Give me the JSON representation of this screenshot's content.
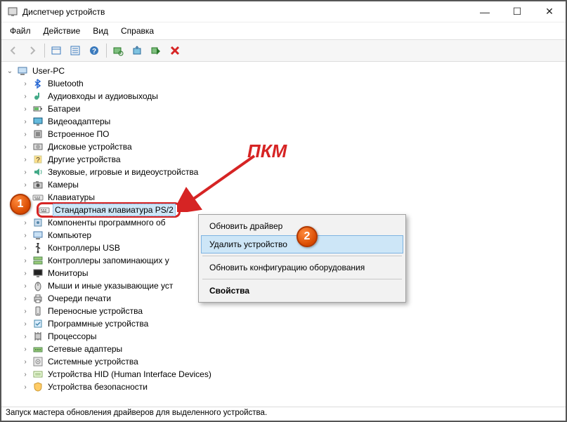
{
  "window": {
    "title": "Диспетчер устройств",
    "controls": {
      "min": "—",
      "max": "☐",
      "close": "✕"
    }
  },
  "menubar": [
    "Файл",
    "Действие",
    "Вид",
    "Справка"
  ],
  "tree": {
    "root": "User-PC",
    "items": [
      {
        "label": "Bluetooth",
        "icon": "bluetooth"
      },
      {
        "label": "Аудиовходы и аудиовыходы",
        "icon": "audio"
      },
      {
        "label": "Батареи",
        "icon": "battery"
      },
      {
        "label": "Видеоадаптеры",
        "icon": "display"
      },
      {
        "label": "Встроенное ПО",
        "icon": "firmware"
      },
      {
        "label": "Дисковые устройства",
        "icon": "disk"
      },
      {
        "label": "Другие устройства",
        "icon": "other"
      },
      {
        "label": "Звуковые, игровые и видеоустройства",
        "icon": "sound"
      },
      {
        "label": "Камеры",
        "icon": "camera"
      },
      {
        "label": "Клавиатуры",
        "icon": "keyboard",
        "expanded": true,
        "children": [
          {
            "label": "Стандартная клавиатура PS/2",
            "icon": "keyboard",
            "selected": true
          }
        ]
      },
      {
        "label": "Компоненты программного об",
        "icon": "software",
        "truncated": true
      },
      {
        "label": "Компьютер",
        "icon": "computer"
      },
      {
        "label": "Контроллеры USB",
        "icon": "usb"
      },
      {
        "label": "Контроллеры запоминающих у",
        "icon": "storage",
        "truncated": true
      },
      {
        "label": "Мониторы",
        "icon": "monitor"
      },
      {
        "label": "Мыши и иные указывающие уст",
        "icon": "mouse",
        "truncated": true
      },
      {
        "label": "Очереди печати",
        "icon": "printer"
      },
      {
        "label": "Переносные устройства",
        "icon": "portable"
      },
      {
        "label": "Программные устройства",
        "icon": "software2"
      },
      {
        "label": "Процессоры",
        "icon": "cpu"
      },
      {
        "label": "Сетевые адаптеры",
        "icon": "network"
      },
      {
        "label": "Системные устройства",
        "icon": "system"
      },
      {
        "label": "Устройства HID (Human Interface Devices)",
        "icon": "hid"
      },
      {
        "label": "Устройства безопасности",
        "icon": "security"
      }
    ]
  },
  "context_menu": {
    "items": [
      {
        "label": "Обновить драйвер"
      },
      {
        "label": "Удалить устройство",
        "hover": true
      },
      {
        "sep": true
      },
      {
        "label": "Обновить конфигурацию оборудования"
      },
      {
        "sep": true
      },
      {
        "label": "Свойства",
        "bold": true
      }
    ]
  },
  "annotations": {
    "label": "ПКМ",
    "badge1": "1",
    "badge2": "2"
  },
  "statusbar": "Запуск мастера обновления драйверов для выделенного устройства."
}
